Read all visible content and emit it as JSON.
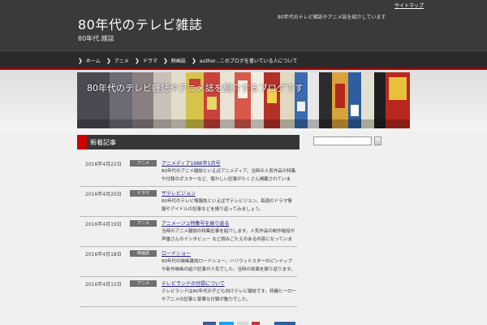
{
  "header": {
    "site_title": "80年代のテレビ雑誌",
    "site_subtitle": "80年代.雑誌",
    "description": "80年代のテレビ雑誌やアニメ誌を紹介しています",
    "top_link": "サイトマップ"
  },
  "nav": {
    "items": [
      {
        "label": "ホーム"
      },
      {
        "label": "アニメ"
      },
      {
        "label": "ドラマ"
      },
      {
        "label": "映画誌"
      },
      {
        "label": "author...このブログを書いている人について"
      }
    ]
  },
  "banner": {
    "text": "80年代のテレビ雑誌やアニメ誌を紹介するブログです"
  },
  "main": {
    "section_title": "新着記事"
  },
  "sidebar": {
    "search_placeholder": ""
  },
  "entries": [
    {
      "date": "2016年4月22日",
      "category": "アニメ",
      "title": "アニメディア1986年1月号",
      "excerpt": "80年代のアニメ雑誌といえばアニメディア。当時の人気作品の特集や付録のポスターなど、懐かしい記事がたくさん掲載されています。 続きを読む"
    },
    {
      "date": "2016年4月20日",
      "category": "ドラマ",
      "title": "ザテレビジョン",
      "excerpt": "80年代のテレビ情報誌といえばザテレビジョン。毎週のドラマ情報やアイドルの記事などを振り返ってみましょう。"
    },
    {
      "date": "2016年4月19日",
      "category": "アニメ",
      "title": "アニメージュ特集号を振り返る",
      "excerpt": "当時のアニメ雑誌の特集記事を紹介します。人気作品の制作秘話や声優さんのインタビュー など読みごたえのある内容になっています。"
    },
    {
      "date": "2016年4月18日",
      "category": "映画誌",
      "title": "ロードショー",
      "excerpt": "80年代の映画雑誌ロードショー。ハリウッドスターのピンナップや新作映画の紹介記事が人気でした。当時の誌面を振り返ります。"
    },
    {
      "date": "2016年4月15日",
      "category": "アニメ",
      "title": "テレビランドの付録について",
      "excerpt": "テレビランドは80年代の子ども向けテレビ雑誌です。特撮ヒーローやアニメの記事と豪華な付録が魅力でした。"
    }
  ],
  "colors": {
    "header_bg": "#3a3a3a",
    "nav_bg": "#2b2b2b",
    "accent_red": "#cc0000",
    "category_bg": "#6f6f6f",
    "link": "#1a1a8a"
  }
}
